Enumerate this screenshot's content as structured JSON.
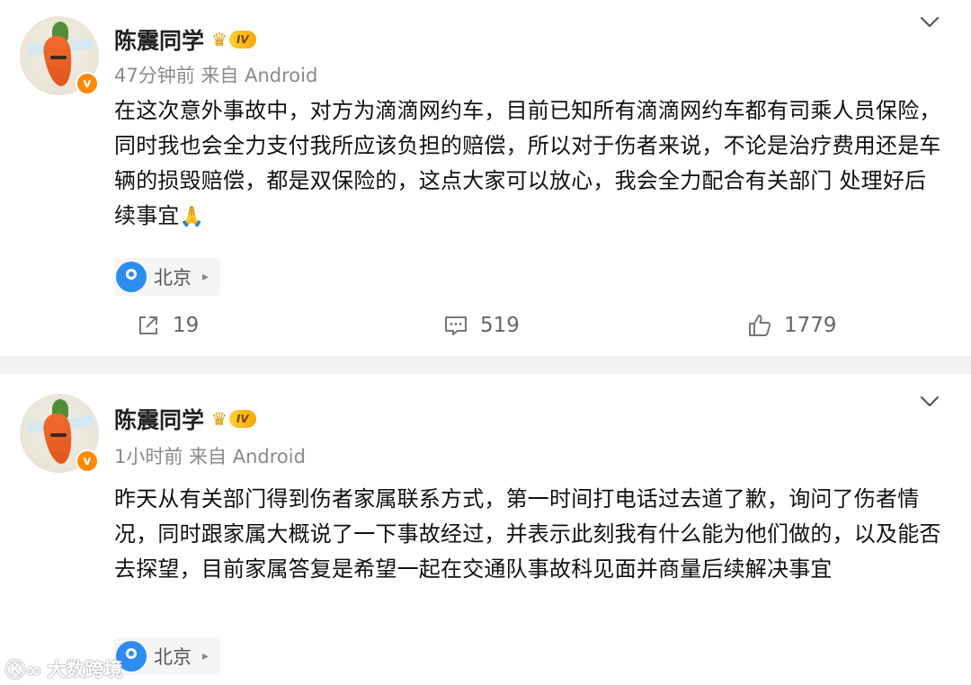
{
  "posts": [
    {
      "author": "陈震同学",
      "vip_level": "IV",
      "time": "47分钟前",
      "source": "来自 Android",
      "text": "在这次意外事故中，对方为滴滴网约车，目前已知所有滴滴网约车都有司乘人员保险，同时我也会全力支付我所应该负担的赔偿，所以对于伤者来说，不论是治疗费用还是车辆的损毁赔偿，都是双保险的，这点大家可以放心，我会全力配合有关部门 处理好后续事宜",
      "emoji": "🙏",
      "location": "北京",
      "shares": "19",
      "comments": "519",
      "likes": "1779"
    },
    {
      "author": "陈震同学",
      "vip_level": "IV",
      "time": "1小时前",
      "source": "来自 Android",
      "text": "昨天从有关部门得到伤者家属联系方式，第一时间打电话过去道了歉，询问了伤者情况，同时跟家属大概说了一下事故经过，并表示此刻我有什么能为他们做的，以及能否去探望，目前家属答复是希望一起在交通队事故科见面并商量后续解决事宜",
      "location": "北京"
    }
  ],
  "watermark": "大数跨境",
  "colors": {
    "vip_badge": "#f4a900",
    "verified_badge": "#ff8a00",
    "location_pin": "#2d8cf0",
    "separator": "#f2f2f2"
  },
  "icons": {
    "share": "share-icon",
    "comment": "comment-icon",
    "like": "thumbs-up-icon",
    "more": "chevron-down-icon",
    "location": "location-pin-icon"
  }
}
